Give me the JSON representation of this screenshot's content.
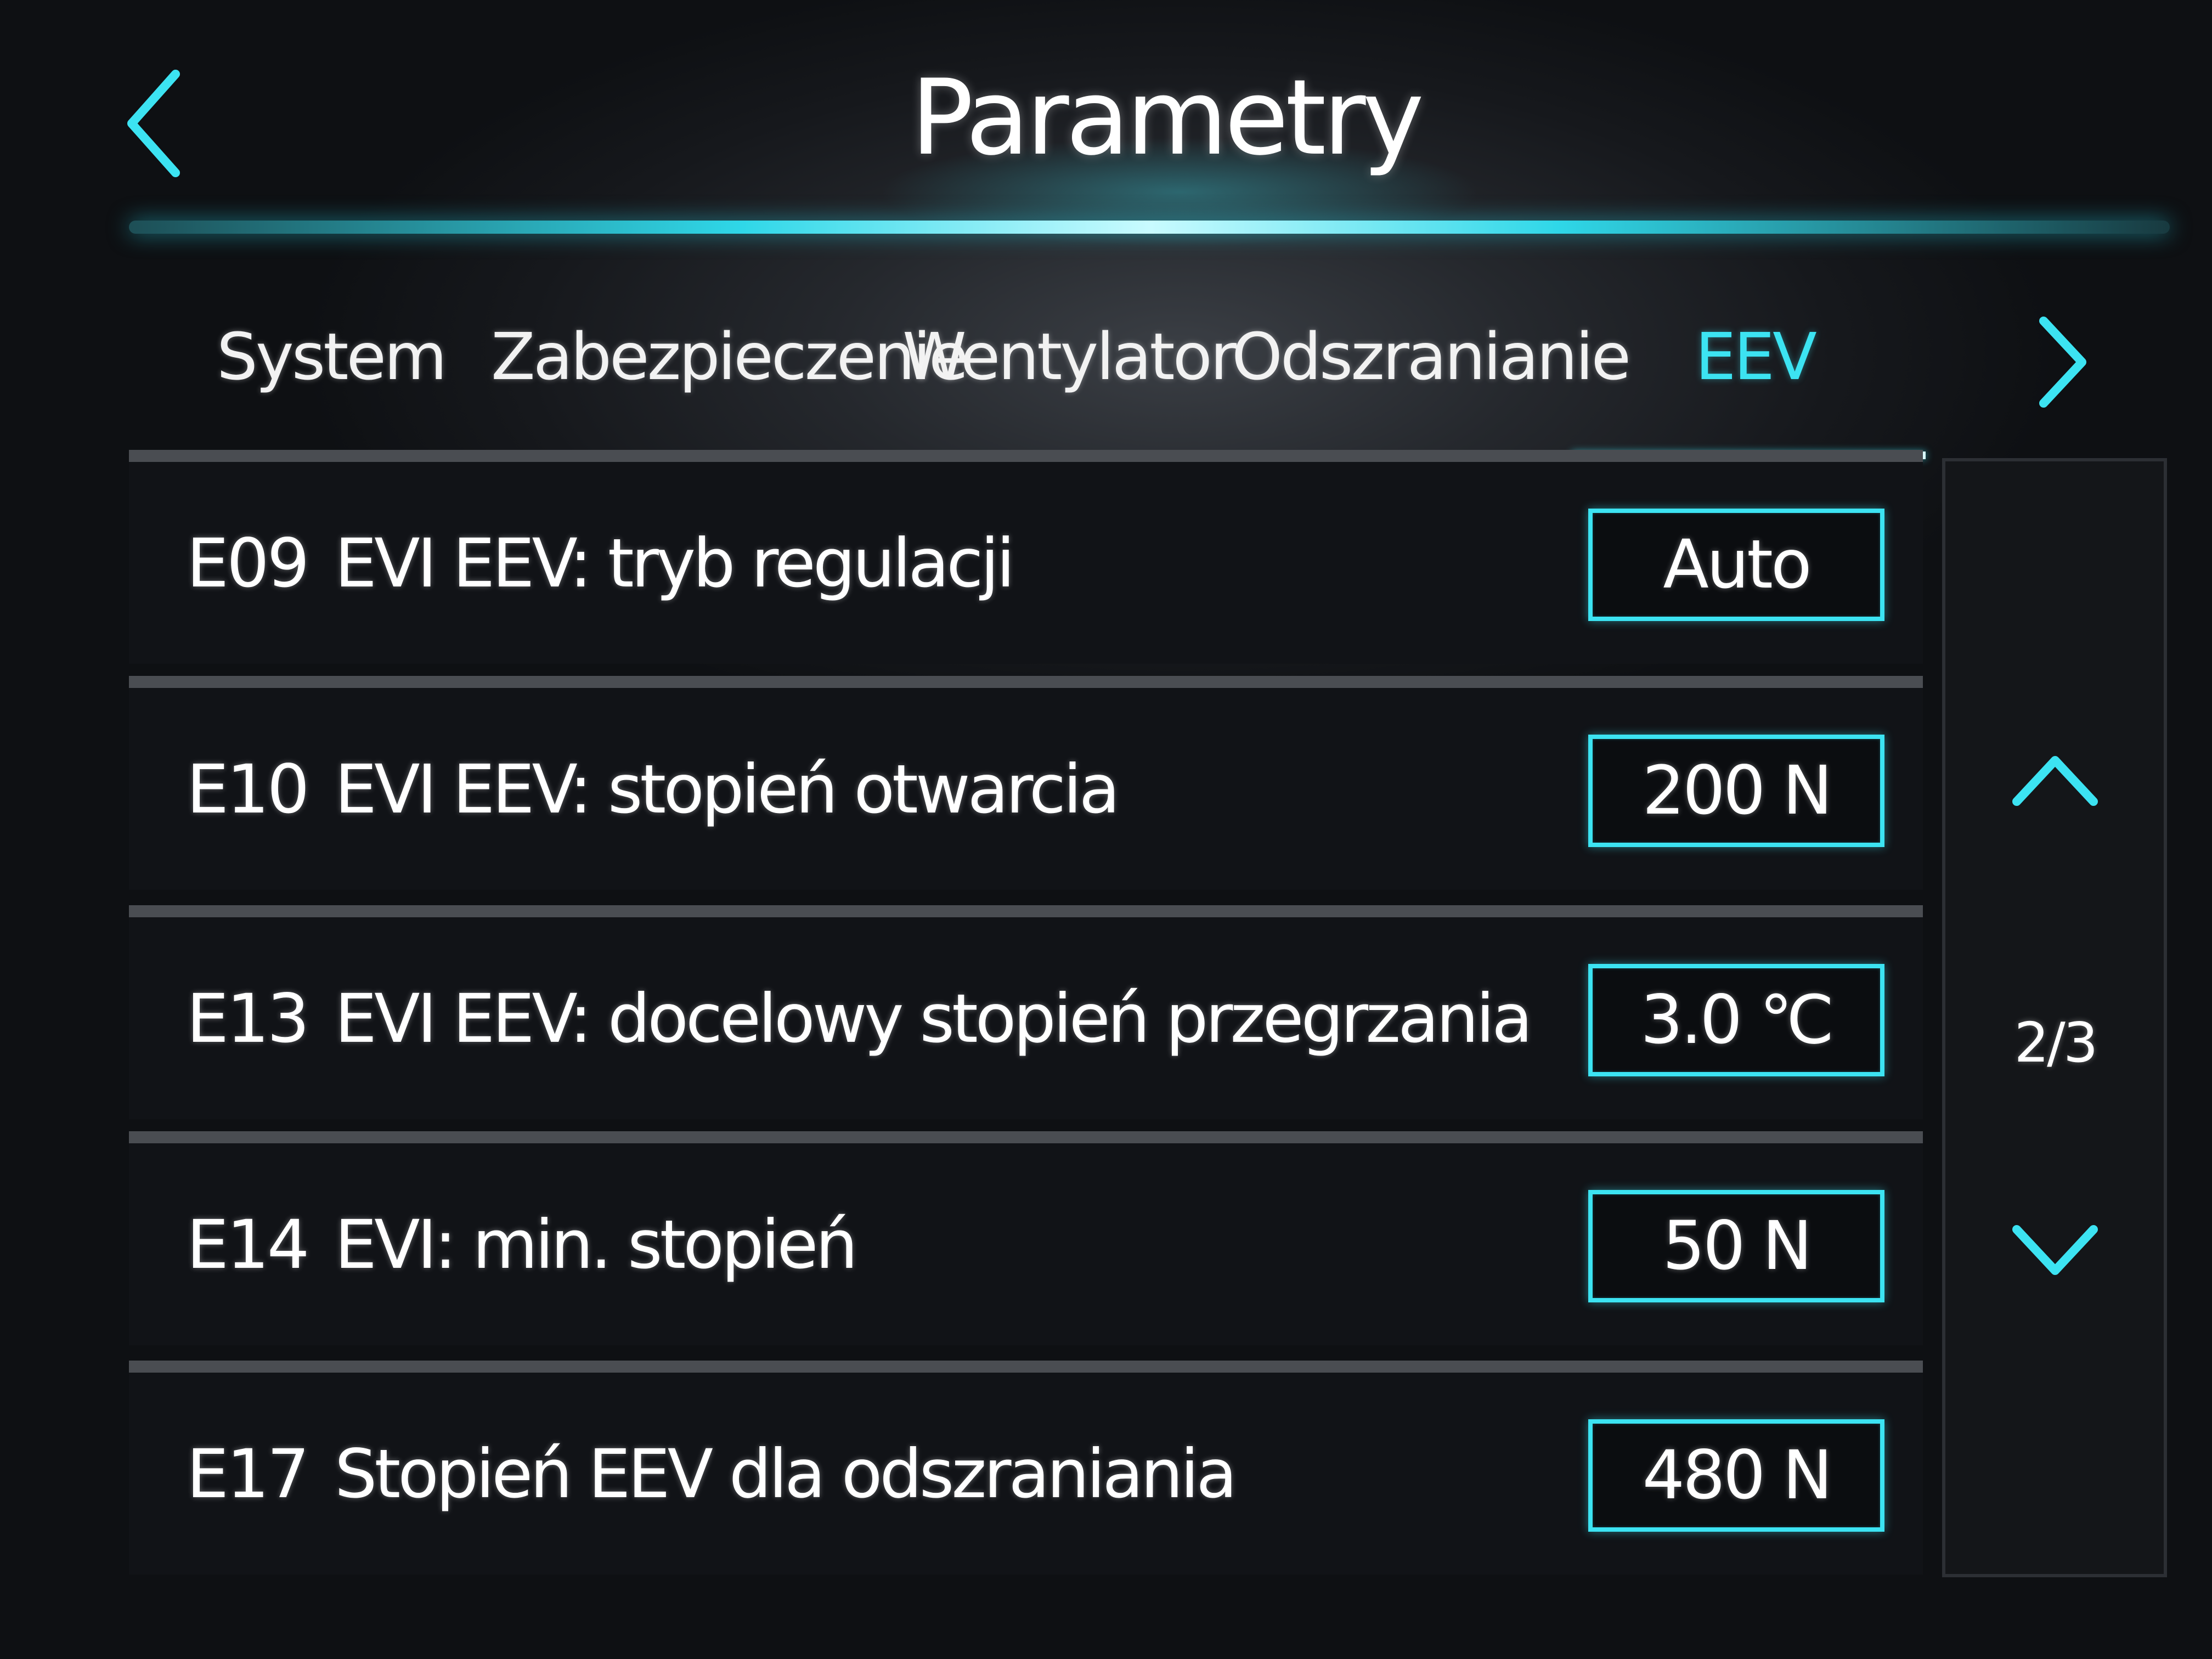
{
  "header": {
    "title": "Parametry",
    "back_icon": "chevron-left-icon"
  },
  "tabs": [
    {
      "label": "System",
      "active": false
    },
    {
      "label": "Zabezpieczenie",
      "active": false
    },
    {
      "label": "Wentylator",
      "active": false
    },
    {
      "label": "Odszranianie",
      "active": false
    },
    {
      "label": "EEV",
      "active": true
    }
  ],
  "tabs_next_icon": "chevron-right-icon",
  "parameters": [
    {
      "code": "E09",
      "label": "EVI EEV: tryb regulacji",
      "value": "Auto"
    },
    {
      "code": "E10",
      "label": "EVI EEV: stopień otwarcia",
      "value": "200 N"
    },
    {
      "code": "E13",
      "label": "EVI EEV: docelowy stopień przegrzania",
      "value": "3.0 ℃"
    },
    {
      "code": "E14",
      "label": "EVI: min. stopień",
      "value": "50 N"
    },
    {
      "code": "E17",
      "label": "Stopień EEV dla odszraniania",
      "value": "480 N"
    }
  ],
  "pager": {
    "page_indicator": "2/3",
    "up_icon": "chevron-up-icon",
    "down_icon": "chevron-down-icon"
  },
  "colors": {
    "accent": "#3ce3f2",
    "background": "#111317",
    "text": "#ffffff"
  }
}
